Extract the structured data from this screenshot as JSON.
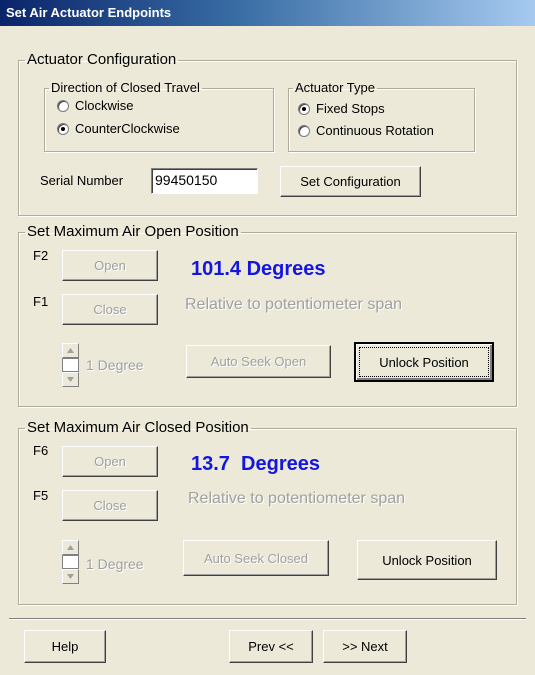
{
  "window": {
    "title": "Set Air Actuator Endpoints"
  },
  "config": {
    "legend": "Actuator Configuration",
    "direction": {
      "legend": "Direction of Closed Travel",
      "options": [
        {
          "label": "Clockwise",
          "selected": false
        },
        {
          "label": "CounterClockwise",
          "selected": true
        }
      ]
    },
    "type": {
      "legend": "Actuator Type",
      "options": [
        {
          "label": "Fixed Stops",
          "selected": true
        },
        {
          "label": "Continuous Rotation",
          "selected": false
        }
      ]
    },
    "serial_label": "Serial Number",
    "serial_value": "99450150",
    "set_button": "Set Configuration"
  },
  "open_section": {
    "legend": "Set Maximum Air Open Position",
    "fkey_open": "F2",
    "fkey_close": "F1",
    "open_button": "Open",
    "close_button": "Close",
    "degrees": "101.4 Degrees",
    "relative": "Relative to potentiometer span",
    "step_label": "1 Degree",
    "auto_seek": "Auto Seek Open",
    "unlock": "Unlock Position"
  },
  "closed_section": {
    "legend": "Set Maximum Air Closed Position",
    "fkey_open": "F6",
    "fkey_close": "F5",
    "open_button": "Open",
    "close_button": "Close",
    "degrees": "13.7  Degrees",
    "relative": "Relative to potentiometer span",
    "step_label": "1 Degree",
    "auto_seek": "Auto Seek Closed",
    "unlock": "Unlock Position"
  },
  "footer": {
    "help": "Help",
    "prev": "Prev <<",
    "next": ">> Next"
  },
  "colors": {
    "degrees": "#1515e0",
    "title_gradient_start": "#0a246a"
  }
}
